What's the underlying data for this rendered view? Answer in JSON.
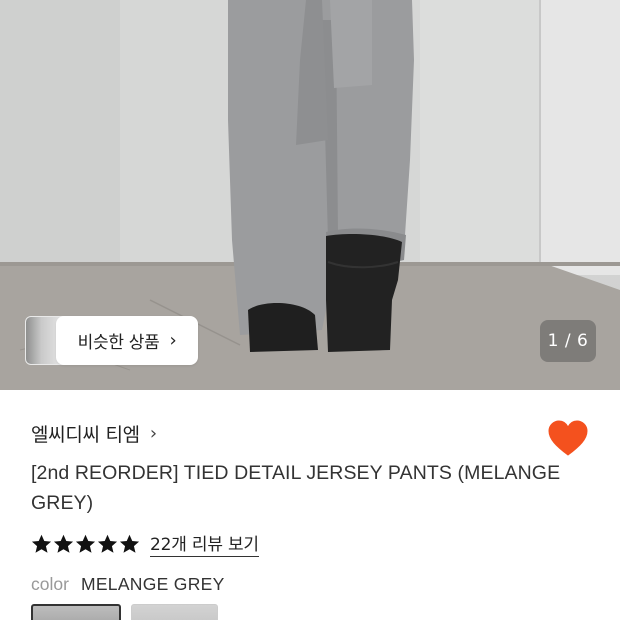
{
  "gallery": {
    "similar_button_label": "비슷한 상품",
    "similar_chevron": "›",
    "pager": "1 / 6"
  },
  "product": {
    "brand": "엘씨디씨 티엠",
    "brand_chevron": "›",
    "title": "[2nd REORDER] TIED DETAIL JERSEY PANTS (MELANGE GREY)",
    "wishlisted": true,
    "rating_stars": 5,
    "review_link": "22개 리뷰 보기",
    "color_label": "color",
    "color_value": "MELANGE GREY"
  },
  "colors": {
    "heart": "#F4511E",
    "star": "#111111"
  }
}
